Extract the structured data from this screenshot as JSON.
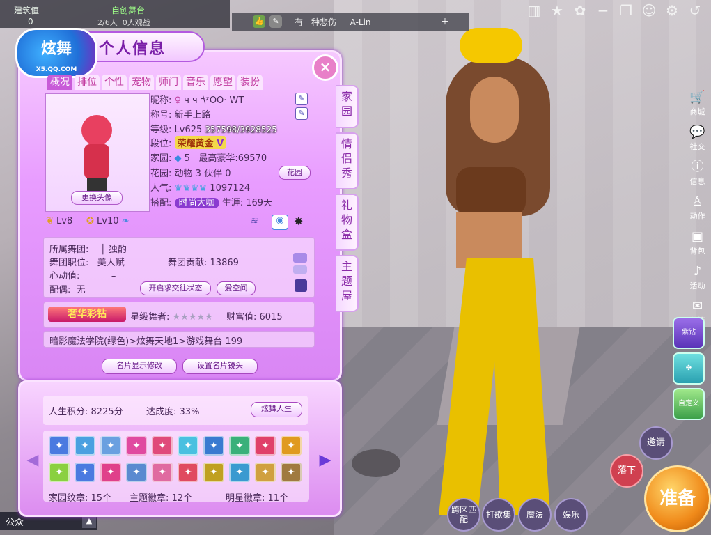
{
  "hud": {
    "build_label": "建筑值",
    "build_value": "0",
    "stage_title": "自创舞台",
    "players": "2/6人",
    "watchers": "0人观战",
    "song": "有一种悲伤 － A-Lin"
  },
  "top_tools": [
    "book-icon",
    "star-icon",
    "gift-icon",
    "minimize-icon",
    "restore-icon",
    "face-icon",
    "gear-icon",
    "back-icon"
  ],
  "right_menu": [
    "商城",
    "社交",
    "信息",
    "动作",
    "背包",
    "活动",
    "邮箱"
  ],
  "side_buttons": [
    "紫钻",
    "",
    "自定义"
  ],
  "bottom_buttons": {
    "cross": "跨区匹配",
    "song_set": "打歌集",
    "magic": "魔法",
    "entertain": "娱乐",
    "drop": "落下",
    "invite": "邀请",
    "ready": "准备"
  },
  "chat": {
    "label": "公众"
  },
  "panel": {
    "logo_text": "炫舞",
    "logo_sub": "X5.QQ.COM",
    "title": "个人信息",
    "tabs": [
      "概况",
      "排位",
      "个性",
      "宠物",
      "师门",
      "音乐",
      "愿望",
      "装扮"
    ],
    "side_tabs": [
      "家园",
      "情侣秀",
      "礼物盒",
      "主题屋"
    ],
    "change_avatar": "更换头像",
    "nickname_label": "昵称:",
    "nickname": "ч ч ヤOO· WT",
    "title_label": "称号:",
    "title_value": "新手上路",
    "level_label": "等级:",
    "level_value": "Lv625",
    "exp": "357598/3928525",
    "rank_label": "段位:",
    "rank_value": "荣耀黄金",
    "rank_suffix": "V",
    "home_label": "家园:",
    "home_value": "5",
    "max_luxury_label": "最高豪华:",
    "max_luxury": "69570",
    "garden_label": "花园:",
    "garden_pets": "动物  3  伙伴  0",
    "garden_btn": "花园",
    "popularity_label": "人气:",
    "popularity": "1097124",
    "style_label": "搭配:",
    "style_value": "时尚大咖",
    "career": "生涯: 169天",
    "lv_a": "Lv8",
    "lv_b": "Lv10",
    "group_label": "所属舞团:",
    "group_value": "独酌",
    "position_label": "舞团职位:",
    "position_value": "美人赋",
    "contribution_label": "舞团贡献:",
    "contribution": "13869",
    "heart_label": "心动值:",
    "heart_value": "–",
    "spouse_label": "配偶:",
    "spouse_value": "无",
    "court_btn": "开启求交往状态",
    "love_btn": "爱空间",
    "vip_logo": "奢华彩钻",
    "star_dancer_label": "星级舞者:",
    "wealth_label": "财富值:",
    "wealth": "6015",
    "location": "暗影魔法学院(绿色)>炫舞天地1>游戏舞台 199",
    "card_edit": "名片显示修改",
    "card_camera": "设置名片镜头"
  },
  "life": {
    "score_label": "人生积分:",
    "score": "8225分",
    "done_label": "达成度:",
    "done": "33%",
    "btn": "炫舞人生",
    "home_badges_label": "家园纹章:",
    "home_badges": "15个",
    "theme_badges_label": "主题徽章:",
    "theme_badges": "12个",
    "star_badges_label": "明星徽章:",
    "star_badges": "11个"
  },
  "badges_colors": [
    "#4a7ae0",
    "#4aa0e0",
    "#6aa0e0",
    "#e04aa0",
    "#e04a7a",
    "#4ac0e0",
    "#3a7ad0",
    "#3ab07a",
    "#e0406a",
    "#e09a20",
    "#8ad040",
    "#4a7ae0",
    "#e0408a",
    "#5a8ad0",
    "#e06aa0",
    "#e04a60",
    "#c0a020",
    "#3a9ad0",
    "#d0a040",
    "#a07a40"
  ]
}
